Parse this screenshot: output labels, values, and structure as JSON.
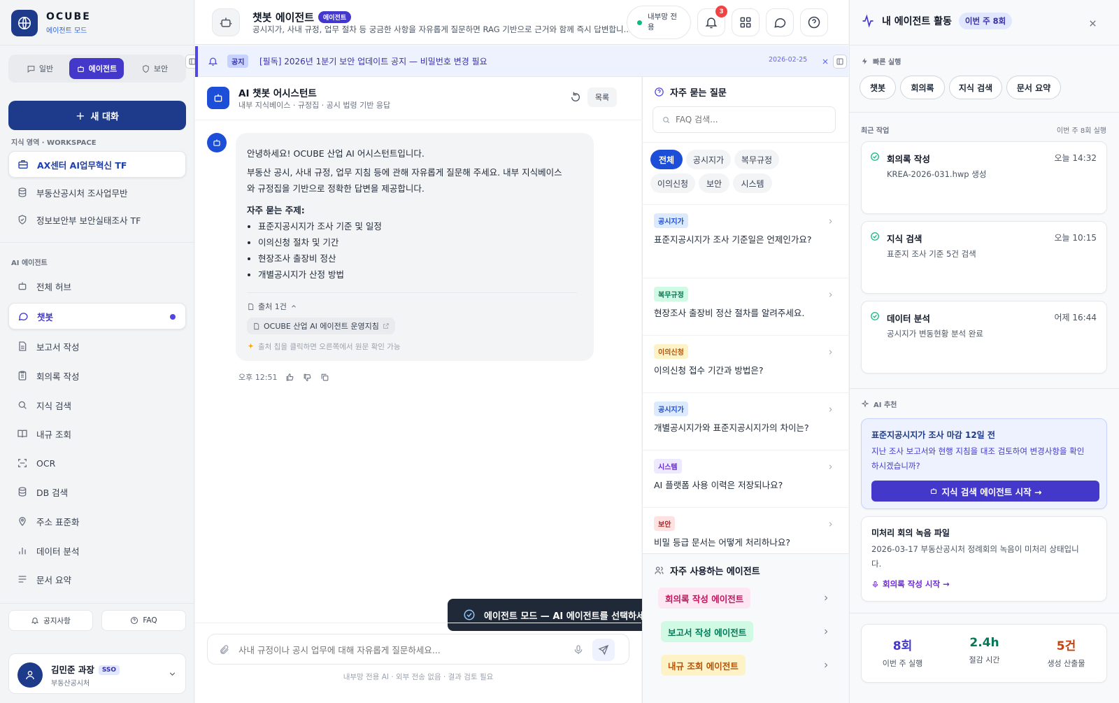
{
  "app": {
    "name": "OCUBE",
    "mode_label": "에이전트 모드"
  },
  "modes": {
    "general": "일반",
    "agent": "에이전트",
    "security": "보안"
  },
  "new_chat": "새 대화",
  "workspace": {
    "label": "지식 영역 · WORKSPACE",
    "items": [
      "AX센터 AI업무혁신 TF",
      "부동산공시처 조사업무반",
      "정보보안부 보안실태조사 TF"
    ]
  },
  "agents_section": {
    "label": "AI 에이전트",
    "items": [
      "전체 허브",
      "챗봇",
      "보고서 작성",
      "회의록 작성",
      "지식 검색",
      "내규 조회",
      "OCR",
      "DB 검색",
      "주소 표준화",
      "데이터 분석",
      "문서 요약"
    ]
  },
  "sidebar_footer": {
    "notice": "공지사항",
    "faq": "FAQ"
  },
  "user": {
    "name": "김민준 과장",
    "sso": "SSO",
    "dept": "부동산공시처"
  },
  "header": {
    "title": "챗봇 에이전트",
    "badge": "에이전트",
    "desc": "공시지가, 사내 규정, 업무 절차 등 궁금한 사항을 자유롭게 질문하면 RAG 기반으로 근거와 함께 즉시 답변합니...",
    "network_line1": "내부망 전",
    "network_line2": "용",
    "notif_count": "3"
  },
  "notice": {
    "tag": "공지",
    "text": "[필독] 2026년 1분기 보안 업데이트 공지 — 비밀번호 변경 필요",
    "date": "2026-02-25"
  },
  "chat": {
    "title": "AI 챗봇 어시스턴트",
    "subtitle": "내부 지식베이스 · 규정집 · 공시 법령 기반 응답",
    "list_btn": "목록",
    "greeting": "안녕하세요! OCUBE 산업 AI 어시스턴트입니다.",
    "intro_1": "부동산 공시, 사내 규정, 업무 지침 등에 관해 자유롭게 질문해 주세요. 내부 지식베이스",
    "intro_2": "와 규정집을 기반으로 정확한 답변을 제공합니다.",
    "topics_title": "자주 묻는 주제:",
    "topics": [
      "표준지공시지가 조사 기준 및 일정",
      "이의신청 절차 및 기간",
      "현장조사 출장비 정산",
      "개별공시지가 산정 방법"
    ],
    "source_count": "출처 1건",
    "source_name": "OCUBE 산업 AI 에이전트 운영지침",
    "source_hint": "출처 칩을 클릭하면 오른쪽에서 원문 확인 가능",
    "time": "오후 12:51",
    "toast": "에이전트 모드 — AI 에이전트를 선택하세요.",
    "input_placeholder": "사내 규정이나 공시 업무에 대해 자유롭게 질문하세요...",
    "disclaimer": "내부망 전용 AI · 외부 전송 없음 · 결과 검토 필요"
  },
  "faq": {
    "title": "자주 묻는 질문",
    "search_placeholder": "FAQ 검색...",
    "filters": [
      "전체",
      "공시지가",
      "복무규정",
      "이의신청",
      "보안",
      "시스템"
    ],
    "items": [
      {
        "tag": "공시지가",
        "q": "표준지공시지가 조사 기준일은 언제인가요?"
      },
      {
        "tag": "복무규정",
        "q": "현장조사 출장비 정산 절차를 알려주세요."
      },
      {
        "tag": "이의신청",
        "q": "이의신청 접수 기간과 방법은?"
      },
      {
        "tag": "공시지가",
        "q": "개별공시지가와 표준지공시지가의 차이는?"
      },
      {
        "tag": "시스템",
        "q": "AI 플랫폼 사용 이력은 저장되나요?"
      },
      {
        "tag": "보안",
        "q": "비밀 등급 문서는 어떻게 처리하나요?"
      }
    ],
    "frequent_title": "자주 사용하는 에이전트",
    "frequent": [
      "회의록 작성 에이전트",
      "보고서 작성 에이전트",
      "내규 조회 에이전트"
    ]
  },
  "panel": {
    "title": "내 에이전트 활동",
    "week_badge": "이번 주 8회",
    "quick_label": "빠른 실행",
    "quick": [
      "챗봇",
      "회의록",
      "지식 검색",
      "문서 요약"
    ],
    "recent_label": "최근 작업",
    "recent_meta": "이번 주 8회 실행",
    "recent": [
      {
        "title": "회의록 작성",
        "time": "오늘 14:32",
        "desc": "KREA-2026-031.hwp 생성"
      },
      {
        "title": "지식 검색",
        "time": "오늘 10:15",
        "desc": "표준지 조사 기준 5건 검색"
      },
      {
        "title": "데이터 분석",
        "time": "어제 16:44",
        "desc": "공시지가 변동현황 분석 완료"
      }
    ],
    "ai_label": "AI 추천",
    "rec_title": "표준지공시지가 조사 마감 12일 전",
    "rec_desc_1": "지난 조사 보고서와 현행 지침을 대조 검토하여 변경사항을 확인",
    "rec_desc_2": "하시겠습니까?",
    "rec_btn": "지식 검색 에이전트 시작 →",
    "pending_title": "미처리 회의 녹음 파일",
    "pending_desc_1": "2026-03-17 부동산공시처 정례회의 녹음이 미처리 상태입니",
    "pending_desc_2": "다.",
    "pending_link": "회의록 작성 시작 →",
    "stats": [
      {
        "value": "8회",
        "label": "이번 주 실행"
      },
      {
        "value": "2.4h",
        "label": "절감 시간"
      },
      {
        "value": "5건",
        "label": "생성 산출물"
      }
    ]
  },
  "colors": {
    "brand": "#1e3a8a",
    "accent": "#4338ca",
    "primary_blue": "#1d4ed8",
    "stat1": "#4338ca",
    "stat2": "#047857",
    "stat3": "#c2410c"
  }
}
